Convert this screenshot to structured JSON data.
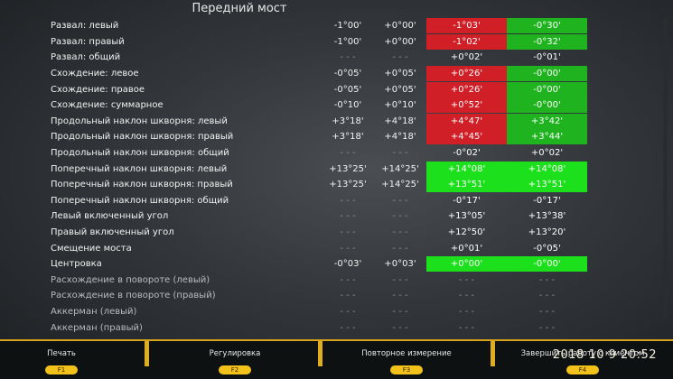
{
  "header": {
    "title": "Передний мост"
  },
  "rows": [
    {
      "label": "Развал: левый",
      "a": "-1°00'",
      "b": "+0°00'",
      "c": "-1°03'",
      "d": "-0°30'",
      "cc": "red",
      "dc": "green"
    },
    {
      "label": "Развал: правый",
      "a": "-1°00'",
      "b": "+0°00'",
      "c": "-1°02'",
      "d": "-0°32'",
      "cc": "red",
      "dc": "green"
    },
    {
      "label": "Развал: общий",
      "a": "- - -",
      "b": "- - -",
      "c": "+0°02'",
      "d": "-0°01'",
      "cc": "",
      "dc": ""
    },
    {
      "label": "Схождение: левое",
      "a": "-0°05'",
      "b": "+0°05'",
      "c": "+0°26'",
      "d": "-0°00'",
      "cc": "red",
      "dc": "green"
    },
    {
      "label": "Схождение: правое",
      "a": "-0°05'",
      "b": "+0°05'",
      "c": "+0°26'",
      "d": "-0°00'",
      "cc": "red",
      "dc": "green"
    },
    {
      "label": "Схождение: суммарное",
      "a": "-0°10'",
      "b": "+0°10'",
      "c": "+0°52'",
      "d": "-0°00'",
      "cc": "red",
      "dc": "green"
    },
    {
      "label": "Продольный наклон шкворня: левый",
      "a": "+3°18'",
      "b": "+4°18'",
      "c": "+4°47'",
      "d": "+3°42'",
      "cc": "red",
      "dc": "green"
    },
    {
      "label": "Продольный наклон шкворня: правый",
      "a": "+3°18'",
      "b": "+4°18'",
      "c": "+4°45'",
      "d": "+3°44'",
      "cc": "red",
      "dc": "green"
    },
    {
      "label": "Продольный наклон шкворня: общий",
      "a": "- - -",
      "b": "- - -",
      "c": "-0°02'",
      "d": "+0°02'",
      "cc": "",
      "dc": ""
    },
    {
      "label": "Поперечный наклон шкворня: левый",
      "a": "+13°25'",
      "b": "+14°25'",
      "c": "+14°08'",
      "d": "+14°08'",
      "cc": "lime",
      "dc": "lime"
    },
    {
      "label": "Поперечный наклон шкворня: правый",
      "a": "+13°25'",
      "b": "+14°25'",
      "c": "+13°51'",
      "d": "+13°51'",
      "cc": "lime",
      "dc": "lime"
    },
    {
      "label": "Поперечный наклон шкворня: общий",
      "a": "- - -",
      "b": "- - -",
      "c": "-0°17'",
      "d": "-0°17'",
      "cc": "",
      "dc": ""
    },
    {
      "label": "Левый включенный угол",
      "a": "- - -",
      "b": "- - -",
      "c": "+13°05'",
      "d": "+13°38'",
      "cc": "",
      "dc": ""
    },
    {
      "label": "Правый включенный угол",
      "a": "- - -",
      "b": "- - -",
      "c": "+12°50'",
      "d": "+13°20'",
      "cc": "",
      "dc": ""
    },
    {
      "label": "Смещение моста",
      "a": "- - -",
      "b": "- - -",
      "c": "+0°01'",
      "d": "-0°05'",
      "cc": "",
      "dc": ""
    },
    {
      "label": "Центровка",
      "a": "-0°03'",
      "b": "+0°03'",
      "c": "+0°00'",
      "d": "-0°00'",
      "cc": "lime",
      "dc": "lime"
    },
    {
      "label": "Расхождение в повороте (левый)",
      "a": "- - -",
      "b": "- - -",
      "c": "- - -",
      "d": "- - -",
      "cc": "",
      "dc": ""
    },
    {
      "label": "Расхождение в повороте (правый)",
      "a": "- - -",
      "b": "- - -",
      "c": "- - -",
      "d": "- - -",
      "cc": "",
      "dc": ""
    },
    {
      "label": "Аккерман (левый)",
      "a": "- - -",
      "b": "- - -",
      "c": "- - -",
      "d": "- - -",
      "cc": "",
      "dc": ""
    },
    {
      "label": "Аккерман (правый)",
      "a": "- - -",
      "b": "- - -",
      "c": "- - -",
      "d": "- - -",
      "cc": "",
      "dc": ""
    }
  ],
  "footer": {
    "buttons": [
      {
        "label": "Печать",
        "key": "F1"
      },
      {
        "label": "Регулировка",
        "key": "F2"
      },
      {
        "label": "Повторное измерение",
        "key": "F3"
      },
      {
        "label": "Завершить работу с клиентом",
        "key": "F4"
      }
    ]
  },
  "timestamp": "2018 10 9 20:52",
  "colors": {
    "red": "#d11f27",
    "green": "#1fb41f",
    "lime": "#1ce01c",
    "accent": "#e0ad1f"
  }
}
